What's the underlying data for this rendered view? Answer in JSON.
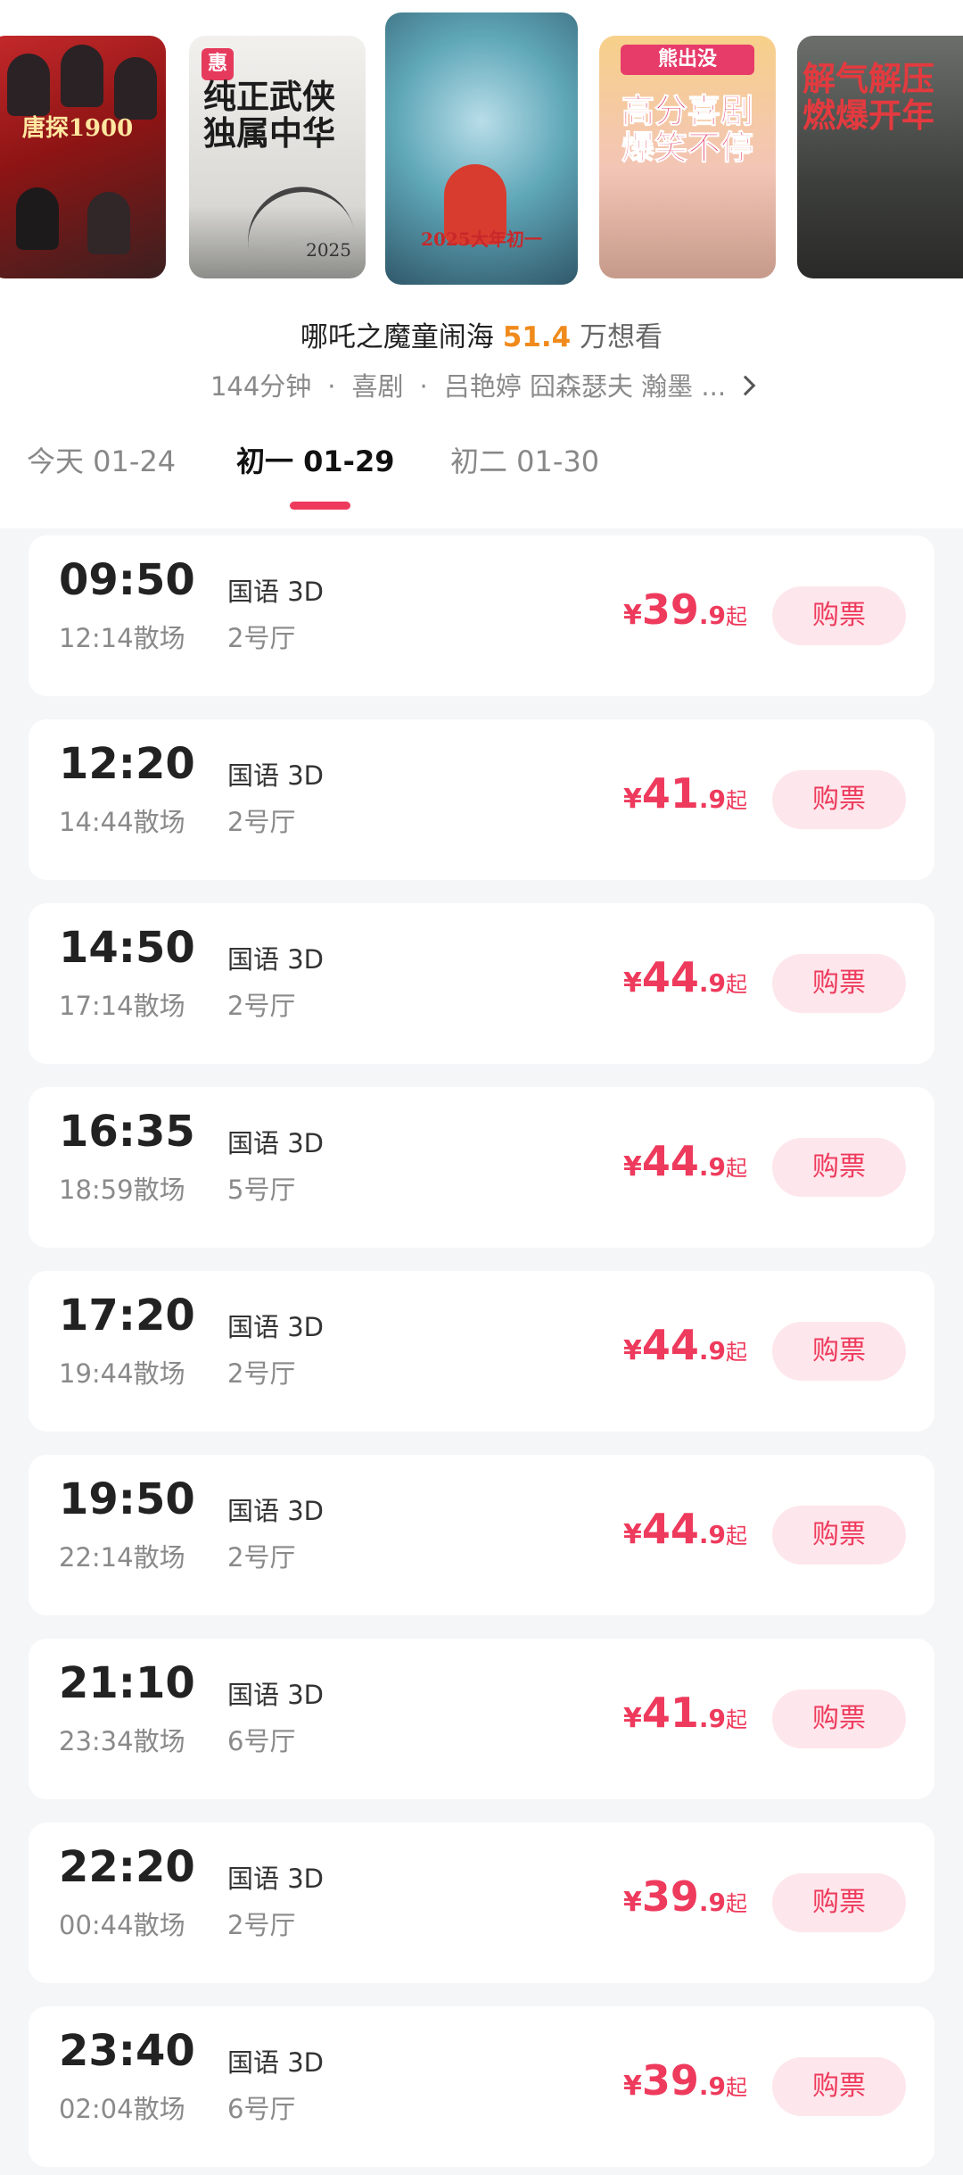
{
  "posters": [
    {
      "name": "poster-1",
      "text": "唐探1900"
    },
    {
      "name": "poster-2",
      "badge": "惠",
      "text": "纯正武侠\n独属中华",
      "year": "2025"
    },
    {
      "name": "poster-3",
      "text": "2025大年初一"
    },
    {
      "name": "poster-4",
      "header": "熊出没",
      "text": "高分喜剧\n爆笑不停"
    },
    {
      "name": "poster-5",
      "text": "解气解压\n燃爆开年"
    }
  ],
  "movie": {
    "title": "哪吒之魔童闹海",
    "want_count": "51.4",
    "want_unit": "万想看",
    "duration": "144分钟",
    "genre": "喜剧",
    "cast": "吕艳婷  囧森瑟夫  瀚墨 ..."
  },
  "dates": [
    {
      "label": "今天 01-24",
      "active": false
    },
    {
      "label": "初一 01-29",
      "active": true
    },
    {
      "label": "初二 01-30",
      "active": false
    }
  ],
  "showtimes": [
    {
      "start": "09:50",
      "end": "12:14散场",
      "lang": "国语 3D",
      "hall": "2号厅",
      "currency": "¥",
      "price_int": "39",
      "price_dec": ".9",
      "suffix": "起",
      "button": "购票"
    },
    {
      "start": "12:20",
      "end": "14:44散场",
      "lang": "国语 3D",
      "hall": "2号厅",
      "currency": "¥",
      "price_int": "41",
      "price_dec": ".9",
      "suffix": "起",
      "button": "购票"
    },
    {
      "start": "14:50",
      "end": "17:14散场",
      "lang": "国语 3D",
      "hall": "2号厅",
      "currency": "¥",
      "price_int": "44",
      "price_dec": ".9",
      "suffix": "起",
      "button": "购票"
    },
    {
      "start": "16:35",
      "end": "18:59散场",
      "lang": "国语 3D",
      "hall": "5号厅",
      "currency": "¥",
      "price_int": "44",
      "price_dec": ".9",
      "suffix": "起",
      "button": "购票"
    },
    {
      "start": "17:20",
      "end": "19:44散场",
      "lang": "国语 3D",
      "hall": "2号厅",
      "currency": "¥",
      "price_int": "44",
      "price_dec": ".9",
      "suffix": "起",
      "button": "购票"
    },
    {
      "start": "19:50",
      "end": "22:14散场",
      "lang": "国语 3D",
      "hall": "2号厅",
      "currency": "¥",
      "price_int": "44",
      "price_dec": ".9",
      "suffix": "起",
      "button": "购票"
    },
    {
      "start": "21:10",
      "end": "23:34散场",
      "lang": "国语 3D",
      "hall": "6号厅",
      "currency": "¥",
      "price_int": "41",
      "price_dec": ".9",
      "suffix": "起",
      "button": "购票"
    },
    {
      "start": "22:20",
      "end": "00:44散场",
      "lang": "国语 3D",
      "hall": "2号厅",
      "currency": "¥",
      "price_int": "39",
      "price_dec": ".9",
      "suffix": "起",
      "button": "购票"
    },
    {
      "start": "23:40",
      "end": "02:04散场",
      "lang": "国语 3D",
      "hall": "6号厅",
      "currency": "¥",
      "price_int": "39",
      "price_dec": ".9",
      "suffix": "起",
      "button": "购票"
    }
  ],
  "colors": {
    "accent": "#ee3a5c",
    "want_count": "#f08a1c",
    "button_bg": "#fde7ec"
  }
}
